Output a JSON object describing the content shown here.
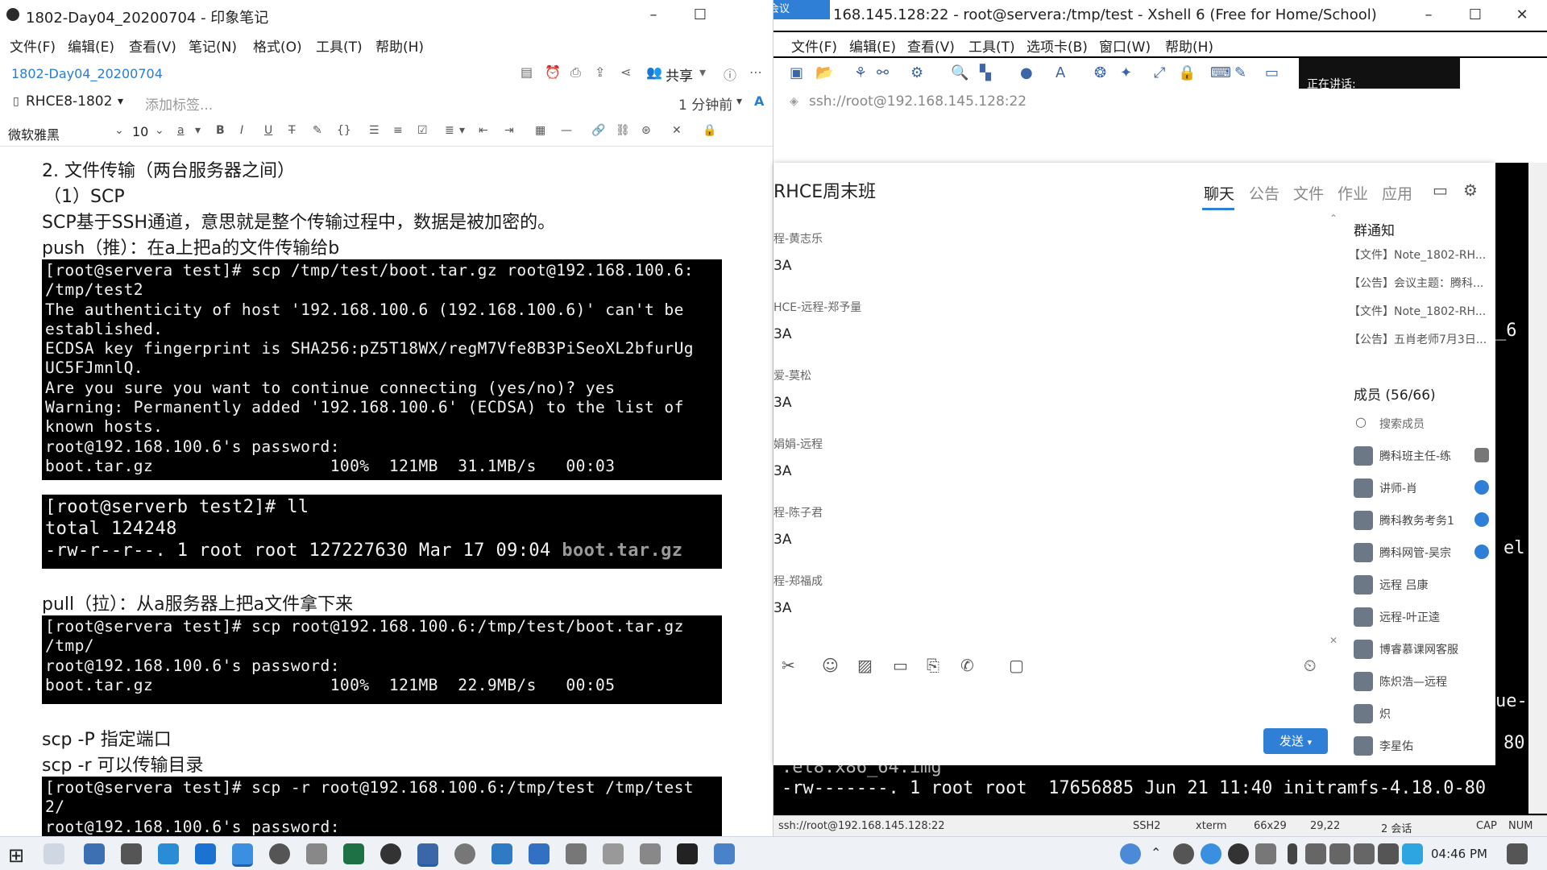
{
  "evernote": {
    "window_title": "1802-Day04_20200704 - 印象笔记",
    "menu": [
      "文件(F)",
      "编辑(E)",
      "查看(V)",
      "笔记(N)",
      "格式(O)",
      "工具(T)",
      "帮助(H)"
    ],
    "notebook_link": "1802-Day04_20200704",
    "share_label": "共享",
    "notebook_name": "RHCE8-1802",
    "add_tag": "添加标签...",
    "modified": "1 分钟前",
    "font_name": "微软雅黑",
    "font_size": "10",
    "content": {
      "heading": "2. 文件传输（两台服务器之间）",
      "sub": "（1）SCP",
      "desc": "SCP基于SSH通道，意思就是整个传输过程中，数据是被加密的。",
      "push": "push（推）：在a上把a的文件传输给b",
      "term1": "[root@servera test]# scp /tmp/test/boot.tar.gz root@192.168.100.6:\n/tmp/test2\nThe authenticity of host '192.168.100.6 (192.168.100.6)' can't be\nestablished.\nECDSA key fingerprint is SHA256:pZ5T18WX/regM7Vfe8B3PiSeoXL2bfurUg\nUC5FJmnlQ.\nAre you sure you want to continue connecting (yes/no)? yes\nWarning: Permanently added '192.168.100.6' (ECDSA) to the list of\nknown hosts.\nroot@192.168.100.6's password:\nboot.tar.gz                  100%  121MB  31.1MB/s   00:03",
      "term2_line1": "[root@serverb test2]# ll",
      "term2_line2": "total 124248",
      "term2_line3": "-rw-r--r--. 1 root root 127227630 Mar 17 09:04 ",
      "term2_file": "boot.tar.gz",
      "pull": "pull（拉）：从a服务器上把a文件拿下来",
      "term3": "[root@servera test]# scp root@192.168.100.6:/tmp/test/boot.tar.gz\n/tmp/\nroot@192.168.100.6's password:\nboot.tar.gz                  100%  121MB  22.9MB/s   00:05",
      "scp_p": "scp -P 指定端口",
      "scp_r": "scp -r 可以传输目录",
      "term4": "[root@servera test]# scp -r root@192.168.100.6:/tmp/test /tmp/test\n2/\nroot@192.168.100.6's password:"
    }
  },
  "xshell": {
    "window_title": "168.145.128:22 - root@servera:/tmp/test - Xshell 6 (Free for Home/School)",
    "meeting_badge": "腾讯会议",
    "menu": [
      "文件(F)",
      "编辑(E)",
      "查看(V)",
      "工具(T)",
      "选项卡(B)",
      "窗口(W)",
      "帮助(H)"
    ],
    "address": "ssh://root@192.168.145.128:22",
    "speaking": "正在讲话:",
    "term_right_1": "_6",
    "term_right_2": "el",
    "term_right_3": "ue-",
    "term_right_4": "80",
    "term_bottom_1": ".el8.x86_64.img",
    "term_bottom_2": "-rw-------. 1 root root  17656885 Jun 21 11:40 initramfs-4.18.0-80",
    "status": {
      "conn": "ssh://root@192.168.145.128:22",
      "proto": "SSH2",
      "term": "xterm",
      "size": "66x29",
      "pos": "29,22",
      "sessions": "2 会话",
      "cap": "CAP",
      "num": "NUM"
    }
  },
  "chat": {
    "group_name": "RHCE周末班",
    "tabs": [
      "聊天",
      "公告",
      "文件",
      "作业",
      "应用"
    ],
    "messages": [
      {
        "name": "程-黄志乐",
        "body": "3A"
      },
      {
        "name": "HCE-远程-郑予量",
        "body": "3A"
      },
      {
        "name": "爱-莫松",
        "body": "3A"
      },
      {
        "name": "娟娟-远程",
        "body": "3A"
      },
      {
        "name": "程-陈子君",
        "body": "3A"
      },
      {
        "name": "程-郑福成",
        "body": "3A"
      }
    ],
    "notice_title": "群通知",
    "notices": [
      "【文件】Note_1802-RH...",
      "【公告】会议主题：腾科...",
      "【文件】Note_1802-RH...",
      "【公告】五肖老师7月3日..."
    ],
    "members_title": "成员 (56/66)",
    "search_member": "搜索成员",
    "members": [
      "腾科班主任-练",
      "讲师-肖",
      "腾科教务考务1",
      "腾科网管-吴宗",
      "远程 吕康",
      "远程-叶正逵",
      "博睿慕课网客服",
      "陈炽浩—远程",
      "炽",
      "李星佑"
    ],
    "send": "发送"
  },
  "taskbar": {
    "time": "04:46 PM"
  }
}
